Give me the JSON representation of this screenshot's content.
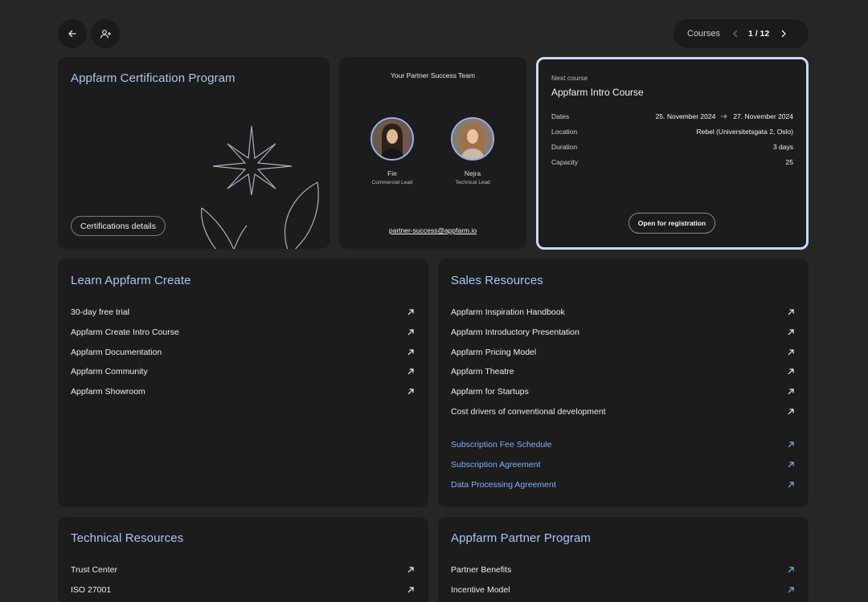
{
  "header": {
    "pager_label": "Courses",
    "pager_count": "1 / 12"
  },
  "cert": {
    "title": "Appfarm Certification Program",
    "button": "Certifications details"
  },
  "team": {
    "title": "Your Partner Success Team",
    "members": [
      {
        "name": "Fie",
        "role": "Commercial Lead"
      },
      {
        "name": "Nejra",
        "role": "Technical Lead"
      }
    ],
    "email": "partner-success@appfarm.io"
  },
  "next_course": {
    "kicker": "Next course",
    "title": "Appfarm Intro Course",
    "rows": [
      {
        "key": "Dates",
        "from": "25. November 2024",
        "to": "27. November 2024"
      },
      {
        "key": "Location",
        "value": "Rebel (Universitetsgata 2, Oslo)"
      },
      {
        "key": "Duration",
        "value": "3 days"
      },
      {
        "key": "Capacity",
        "value": "25"
      }
    ],
    "button": "Open for registration"
  },
  "learn": {
    "title": "Learn Appfarm Create",
    "items": [
      "30-day free trial",
      "Appfarm Create Intro Course",
      "Appfarm Documentation",
      "Appfarm Community",
      "Appfarm Showroom"
    ]
  },
  "sales": {
    "title": "Sales Resources",
    "items": [
      "Appfarm Inspiration Handbook",
      "Appfarm Introductory Presentation",
      "Appfarm Pricing Model",
      "Appfarm Theatre",
      "Appfarm for Startups",
      "Cost drivers of conventional development"
    ],
    "legal_items": [
      "Subscription Fee Schedule",
      "Subscription Agreement",
      "Data Processing Agreement"
    ]
  },
  "technical": {
    "title": "Technical Resources",
    "items": [
      "Trust Center",
      "ISO 27001"
    ]
  },
  "partner": {
    "title": "Appfarm Partner Program",
    "items": [
      "Partner Benefits",
      "Incentive Model"
    ]
  },
  "colors": {
    "accent": "#a9c6f4",
    "link_blue": "#7fb0f5",
    "card": "#1c1c1c",
    "background": "#262626"
  }
}
